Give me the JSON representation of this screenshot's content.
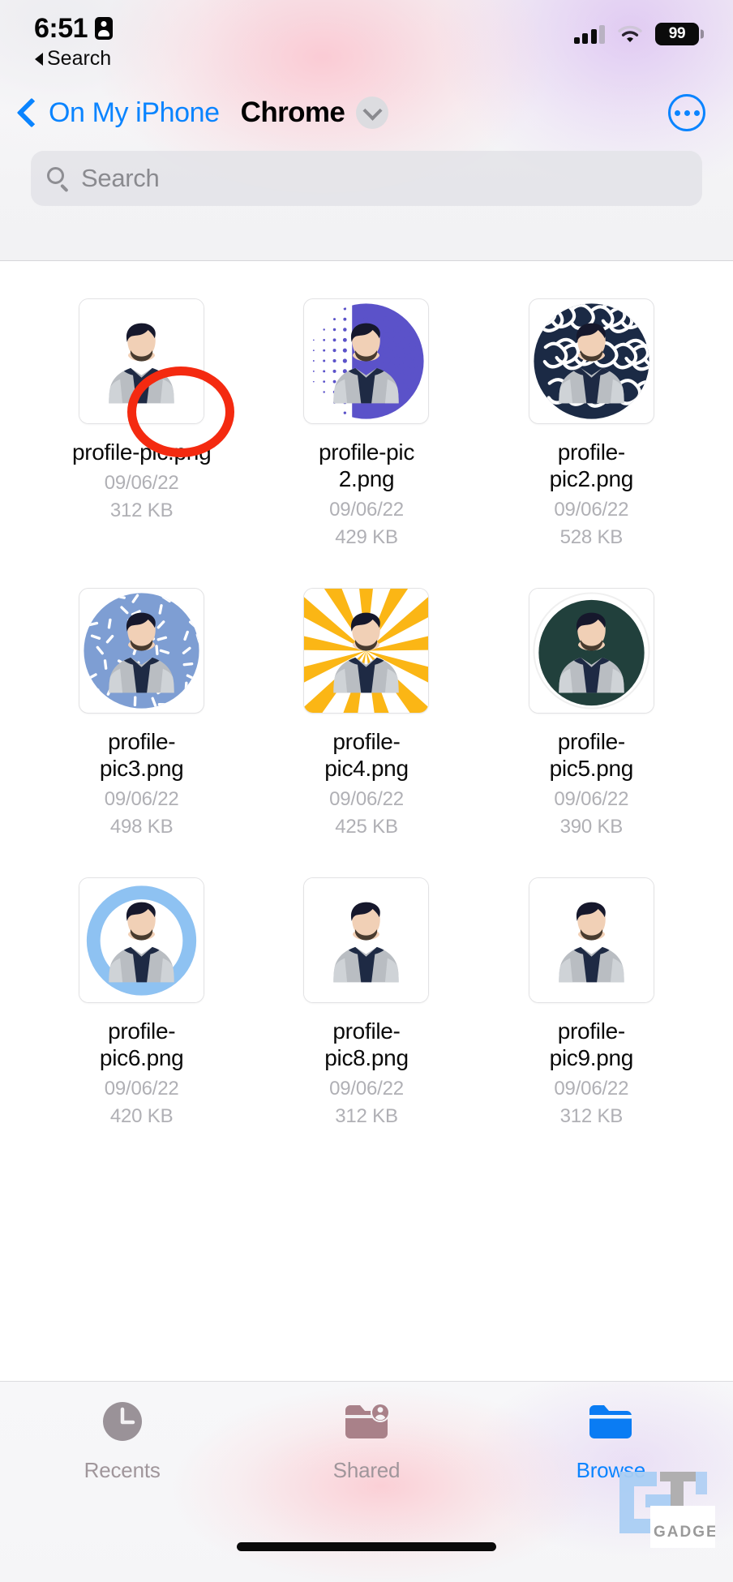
{
  "status_bar": {
    "time": "6:51",
    "carrier_icon": "contact-card-icon",
    "signal_icon": "cellular-signal-icon",
    "wifi_icon": "wifi-icon",
    "battery_level": "99",
    "back_to_app_label": "Search",
    "back_to_app_icon": "triangle-left-icon"
  },
  "nav_bar": {
    "back_label": "On My iPhone",
    "back_icon": "chevron-left-icon",
    "title": "Chrome",
    "title_chevron_icon": "chevron-down-icon",
    "more_icon": "ellipsis-circle-icon"
  },
  "search": {
    "placeholder": "Search",
    "value": "",
    "icon": "search-icon"
  },
  "files": [
    {
      "name": "profile-pic.png",
      "date": "09/06/22",
      "size": "312 KB",
      "style": "plain",
      "accent": "#ffffff"
    },
    {
      "name": "profile-pic\n2.png",
      "date": "09/06/22",
      "size": "429 KB",
      "style": "halftone",
      "accent": "#5b52c9"
    },
    {
      "name": "profile-\npic2.png",
      "date": "09/06/22",
      "size": "528 KB",
      "style": "maze",
      "accent": "#1b2a45"
    },
    {
      "name": "profile-\npic3.png",
      "date": "09/06/22",
      "size": "498 KB",
      "style": "confetti",
      "accent": "#7e9ed3"
    },
    {
      "name": "profile-\npic4.png",
      "date": "09/06/22",
      "size": "425 KB",
      "style": "sunburst",
      "accent": "#fbb615"
    },
    {
      "name": "profile-\npic5.png",
      "date": "09/06/22",
      "size": "390 KB",
      "style": "solid",
      "accent": "#21403c"
    },
    {
      "name": "profile-\npic6.png",
      "date": "09/06/22",
      "size": "420 KB",
      "style": "ring",
      "accent": "#8ec2f2"
    },
    {
      "name": "profile-\npic8.png",
      "date": "09/06/22",
      "size": "312 KB",
      "style": "plain",
      "accent": "#ffffff"
    },
    {
      "name": "profile-\npic9.png",
      "date": "09/06/22",
      "size": "312 KB",
      "style": "plain",
      "accent": "#ffffff"
    }
  ],
  "partial_row": [
    {
      "accent": "#5bbfc7",
      "style": "teal"
    },
    {
      "accent": "",
      "style": "none"
    },
    {
      "accent": "#f04b22",
      "style": "navy-orange"
    }
  ],
  "tab_bar": {
    "tabs": [
      {
        "label": "Recents",
        "icon": "clock-icon",
        "active": false
      },
      {
        "label": "Shared",
        "icon": "folder-person-icon",
        "active": false
      },
      {
        "label": "Browse",
        "icon": "folder-icon",
        "active": true
      }
    ],
    "home_indicator": "home-indicator"
  },
  "annotation": {
    "shape": "red-circle-highlight",
    "color": "#f42a10",
    "target": "profile-pic.png"
  },
  "watermark": {
    "text": "GADGETS"
  },
  "colors": {
    "accent_blue": "#0a84ff",
    "annotation_red": "#f42a10",
    "secondary_text": "#b0b0b5",
    "tab_inactive": "#a0969b"
  }
}
